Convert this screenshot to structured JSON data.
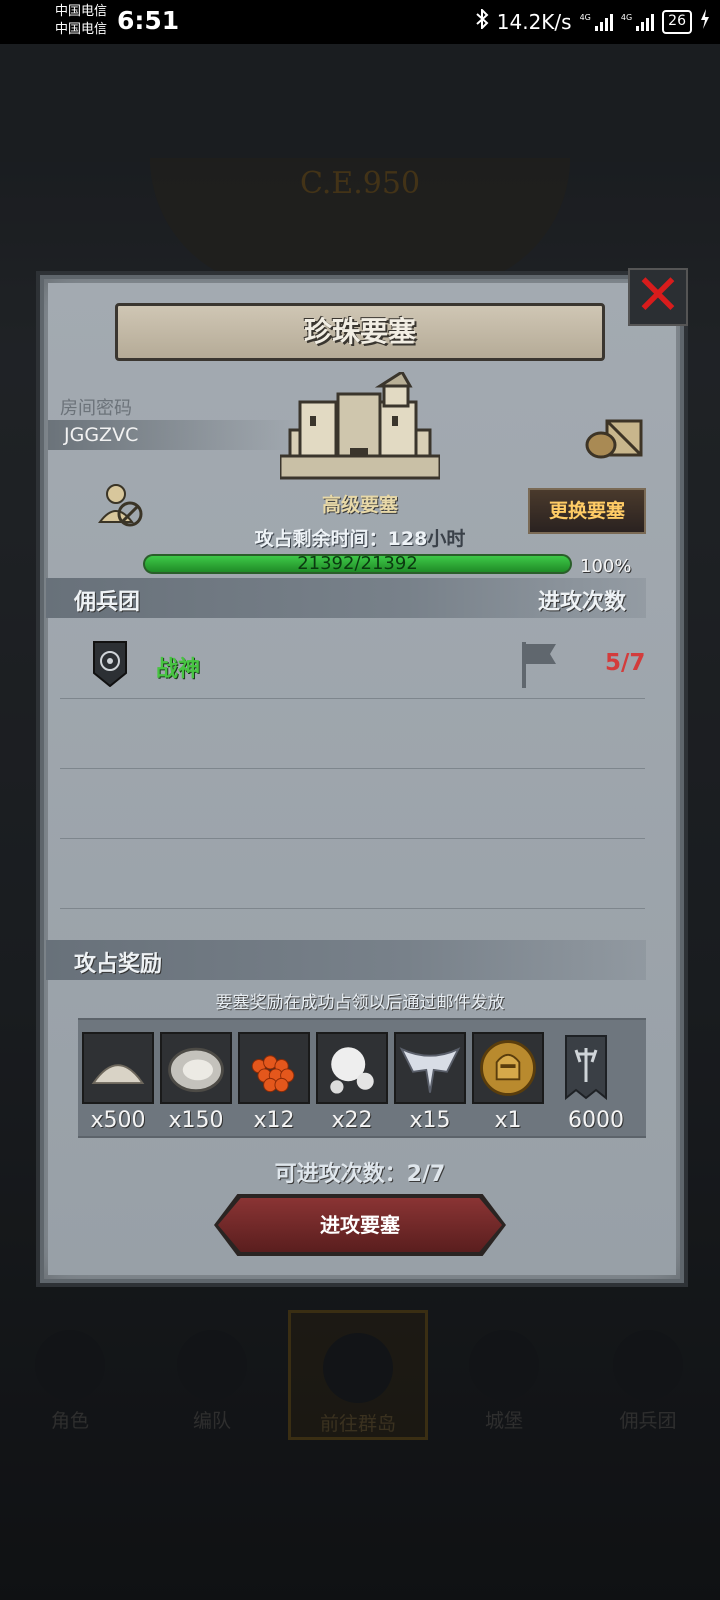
{
  "status_bar": {
    "carrier1": "中国电信",
    "carrier2": "中国电信",
    "time": "6:51",
    "net_speed": "14.2K/s",
    "signal1_label": "4G",
    "signal2_label": "4G",
    "battery": "26"
  },
  "background": {
    "era_text": "C.E.950"
  },
  "dialog": {
    "title": "珍珠要塞",
    "room_password_label": "房间密码",
    "room_password": "JGGZVC",
    "fortress_type": "高级要塞",
    "change_button": "更换要塞",
    "time_label": "攻占剩余时间：",
    "time_value": "128",
    "time_unit": "小时",
    "hp_text": "21392/21392",
    "hp_percent": "100%",
    "hp_fraction": 1.0,
    "mercenary_header": "佣兵团",
    "attack_count_header": "进攻次数",
    "mercenaries": [
      {
        "name": "战神",
        "attacks": "5/7"
      }
    ],
    "reward_header": "攻占奖励",
    "reward_note": "要塞奖励在成功占领以后通过邮件发放",
    "rewards": [
      {
        "icon": "sand-icon",
        "qty": "x500"
      },
      {
        "icon": "oyster-icon",
        "qty": "x150"
      },
      {
        "icon": "fish-roe-icon",
        "qty": "x12"
      },
      {
        "icon": "pearl-icon",
        "qty": "x22"
      },
      {
        "icon": "wing-emblem-icon",
        "qty": "x15"
      },
      {
        "icon": "knight-medal-icon",
        "qty": "x1"
      },
      {
        "icon": "banner-icon",
        "qty": "6000"
      }
    ],
    "attacks_available_label": "可进攻次数：2/7",
    "attack_button": "进攻要塞"
  },
  "bottom_nav": [
    {
      "label": "角色"
    },
    {
      "label": "编队"
    },
    {
      "label": "前往群岛",
      "active": true
    },
    {
      "label": "城堡"
    },
    {
      "label": "佣兵团"
    }
  ],
  "colors": {
    "accent_red": "#d33c3c",
    "hp_green": "#2fb33a",
    "merc_green": "#47c441",
    "button_gold": "#ffcc66"
  }
}
